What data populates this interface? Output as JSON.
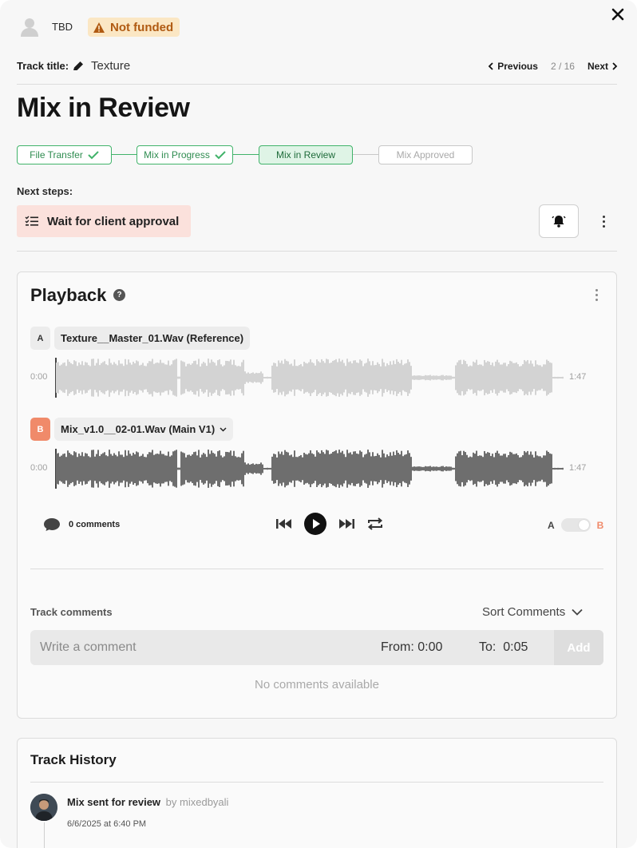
{
  "header": {
    "artist_name": "TBD",
    "funding_status": "Not funded",
    "track_title_label": "Track title:",
    "track_title": "Texture",
    "pager": {
      "previous": "Previous",
      "position": "2 / 16",
      "next": "Next"
    }
  },
  "page_title": "Mix in Review",
  "steps": [
    {
      "label": "File Transfer",
      "state": "done"
    },
    {
      "label": "Mix in Progress",
      "state": "done"
    },
    {
      "label": "Mix in Review",
      "state": "current"
    },
    {
      "label": "Mix Approved",
      "state": "pending"
    }
  ],
  "next_steps": {
    "label": "Next steps:",
    "item": "Wait for client approval"
  },
  "playback": {
    "title": "Playback",
    "help": "?",
    "track_a": {
      "letter": "A",
      "file": "Texture__Master_01.Wav (Reference)",
      "start": "0:00",
      "end": "1:47"
    },
    "track_b": {
      "letter": "B",
      "file": "Mix_v1.0__02-01.Wav (Main V1)",
      "start": "0:00",
      "end": "1:47"
    },
    "comments_count": "0 comments",
    "ab": {
      "a": "A",
      "b": "B"
    }
  },
  "track_comments": {
    "label": "Track comments",
    "sort_label": "Sort Comments",
    "placeholder": "Write a comment",
    "from_label": "From:",
    "from_value": "0:00",
    "to_label": "To:",
    "to_value": "0:05",
    "add_label": "Add",
    "empty": "No comments available"
  },
  "history": {
    "title": "Track History",
    "entries": [
      {
        "event": "Mix sent for review",
        "by": "by mixedbyali",
        "date": "6/6/2025 at 6:40 PM"
      }
    ]
  },
  "colors": {
    "accent_green": "#41b36a",
    "badge_orange": "#b05a12",
    "b_orange": "#f08a6a",
    "next_step_bg": "#fbe1dc"
  }
}
